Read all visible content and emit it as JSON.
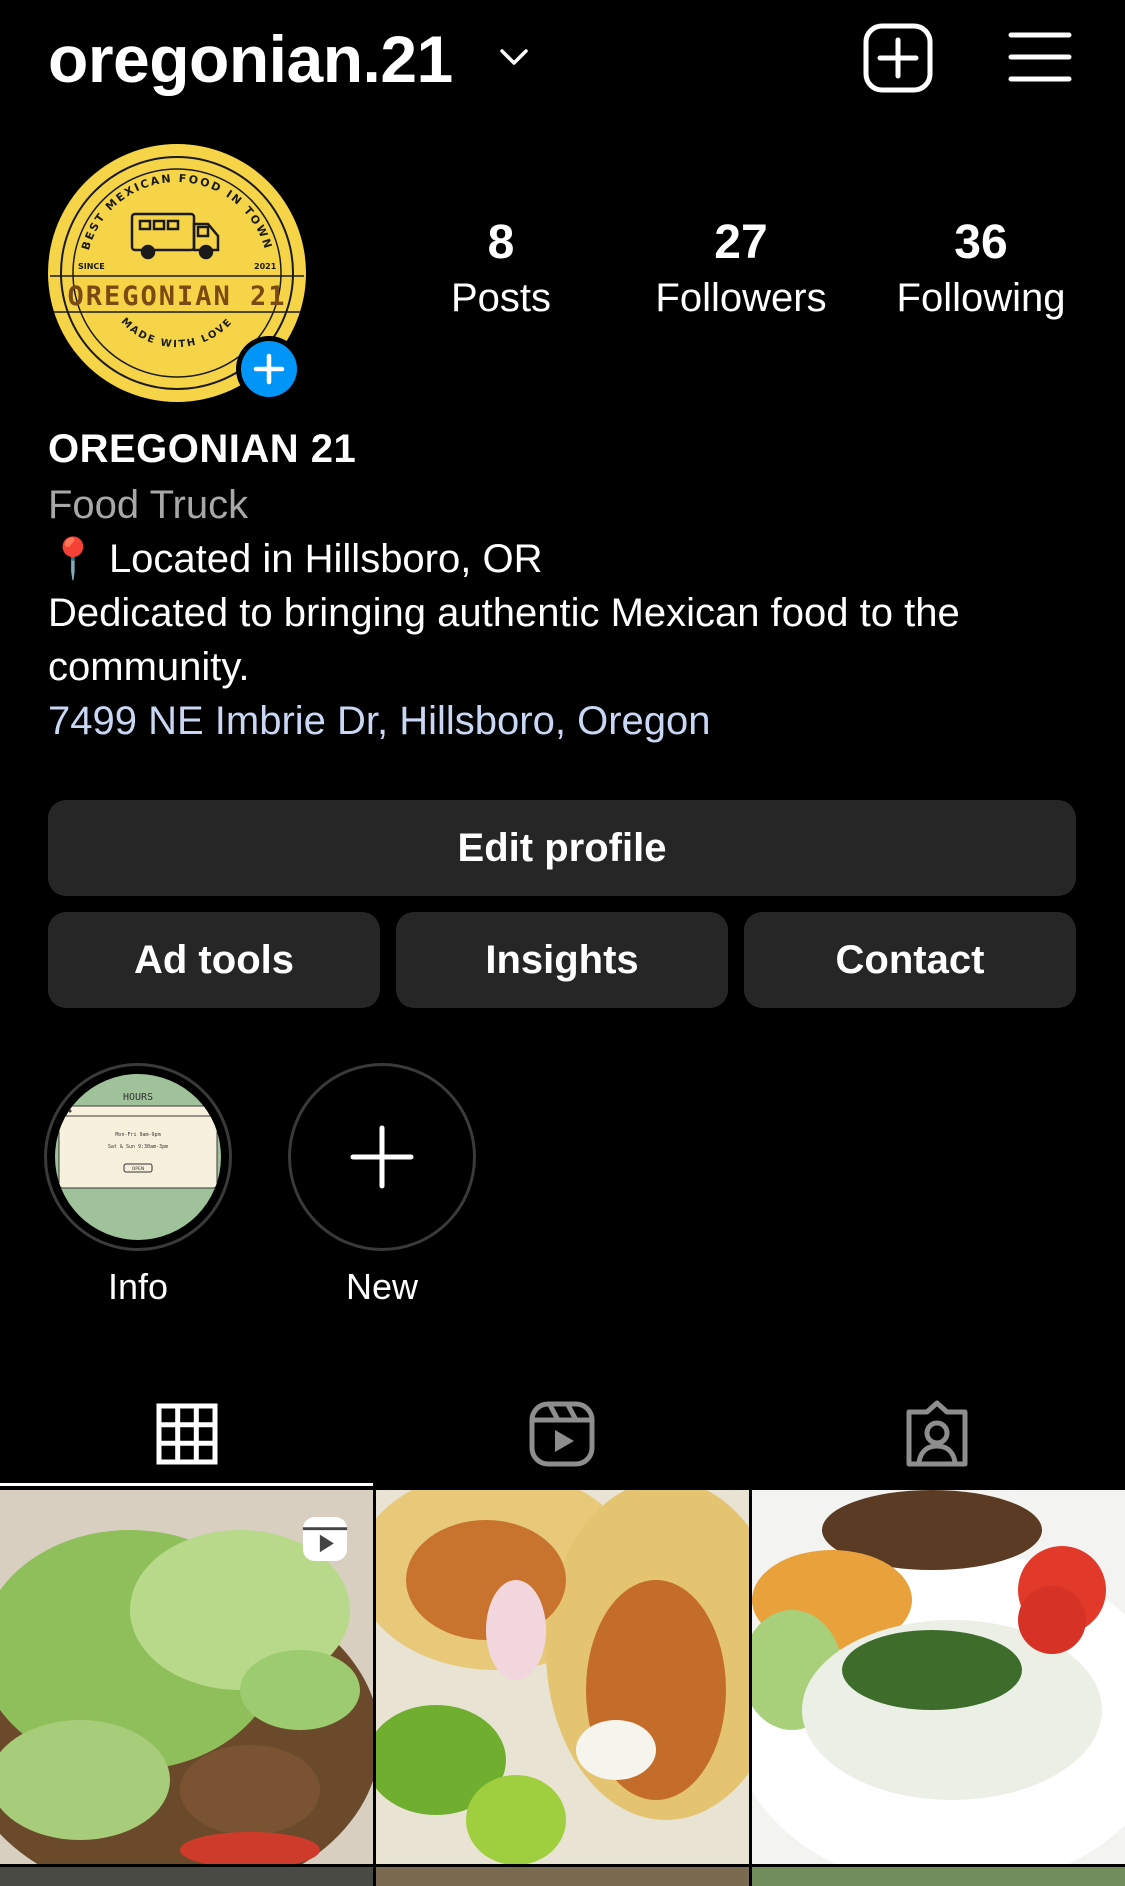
{
  "header": {
    "username": "oregonian.21",
    "icons": [
      "chevron-down-icon",
      "plus-square-icon",
      "hamburger-menu-icon"
    ]
  },
  "profile": {
    "avatar": {
      "arc_top": "BEST MEXICAN FOOD IN TOWN",
      "since": "SINCE",
      "year": "2021",
      "brand": "OREGONIAN 21",
      "arc_bottom": "MADE WITH LOVE",
      "color": "#f5d547"
    },
    "stats": [
      {
        "value": "8",
        "label": "Posts"
      },
      {
        "value": "27",
        "label": "Followers"
      },
      {
        "value": "36",
        "label": "Following"
      }
    ],
    "display_name": "OREGONIAN 21",
    "category": "Food Truck",
    "bio_location_pin": "📍",
    "bio_location": "Located in Hillsboro, OR",
    "bio_line2": "Dedicated to bringing authentic Mexican food to the",
    "bio_line3": "community.",
    "address": "7499 NE Imbrie Dr, Hillsboro, Oregon"
  },
  "buttons": {
    "edit_profile": "Edit profile",
    "ad_tools": "Ad tools",
    "insights": "Insights",
    "contact": "Contact"
  },
  "highlights": [
    {
      "label": "Info",
      "card_title": "HOURS",
      "card_line1": "Mon-Fri 9am-9pm",
      "card_line2": "Sat & Sun 9:30am-3pm",
      "card_button": "OPEN"
    },
    {
      "label": "New"
    }
  ],
  "tabs": [
    {
      "name": "grid",
      "icon": "grid-icon",
      "active": true
    },
    {
      "name": "reels",
      "icon": "reels-icon",
      "active": false
    },
    {
      "name": "tagged",
      "icon": "tagged-person-icon",
      "active": false
    }
  ],
  "colors": {
    "background": "#000000",
    "button_bg": "#262626",
    "accent_blue": "#0095f6",
    "link": "#c9d7f5",
    "muted": "#a8a8a8"
  }
}
